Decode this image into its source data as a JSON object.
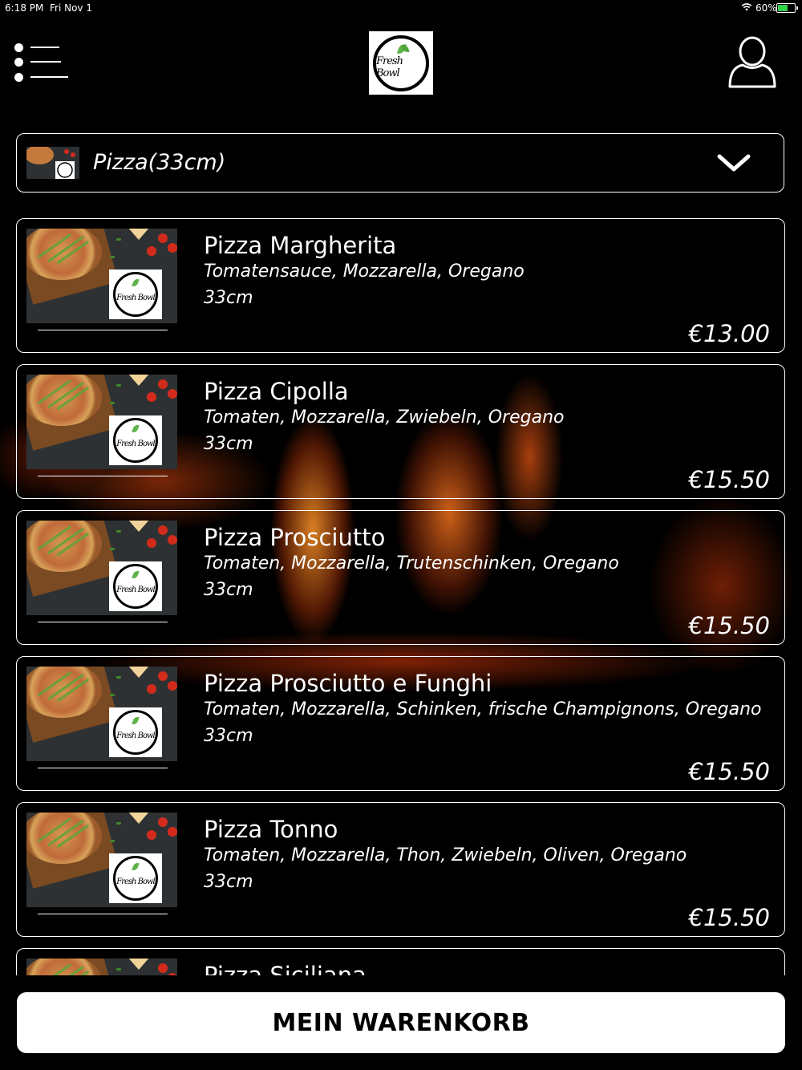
{
  "status_bar": {
    "time": "6:18 PM",
    "date": "Fri Nov 1",
    "battery_percent": "60%",
    "battery_level": 0.6,
    "battery_color": "#35d04a"
  },
  "header": {
    "menu_icon": "list-menu-icon",
    "logo_text": "Fresh Bowl",
    "profile_icon": "user-profile-icon"
  },
  "category": {
    "selected": "Pizza(33cm)",
    "chevron_icon": "chevron-down-icon"
  },
  "items": [
    {
      "name": "Pizza Margherita",
      "description": "Tomatensauce, Mozzarella, Oregano",
      "size": "33cm",
      "price": "€13.00"
    },
    {
      "name": "Pizza Cipolla",
      "description": "Tomaten, Mozzarella, Zwiebeln, Oregano",
      "size": "33cm",
      "price": "€15.50"
    },
    {
      "name": "Pizza Prosciutto",
      "description": "Tomaten, Mozzarella, Trutenschinken, Oregano",
      "size": "33cm",
      "price": "€15.50"
    },
    {
      "name": "Pizza Prosciutto e Funghi",
      "description": "Tomaten, Mozzarella, Schinken, frische Champignons, Oregano",
      "size": "33cm",
      "price": "€15.50"
    },
    {
      "name": "Pizza Tonno",
      "description": "Tomaten, Mozzarella, Thon, Zwiebeln, Oliven, Oregano",
      "size": "33cm",
      "price": "€15.50"
    },
    {
      "name": "Pizza Siciliana",
      "description": "",
      "size": "",
      "price": ""
    }
  ],
  "footer": {
    "cart_label": "MEIN WARENKORB"
  }
}
